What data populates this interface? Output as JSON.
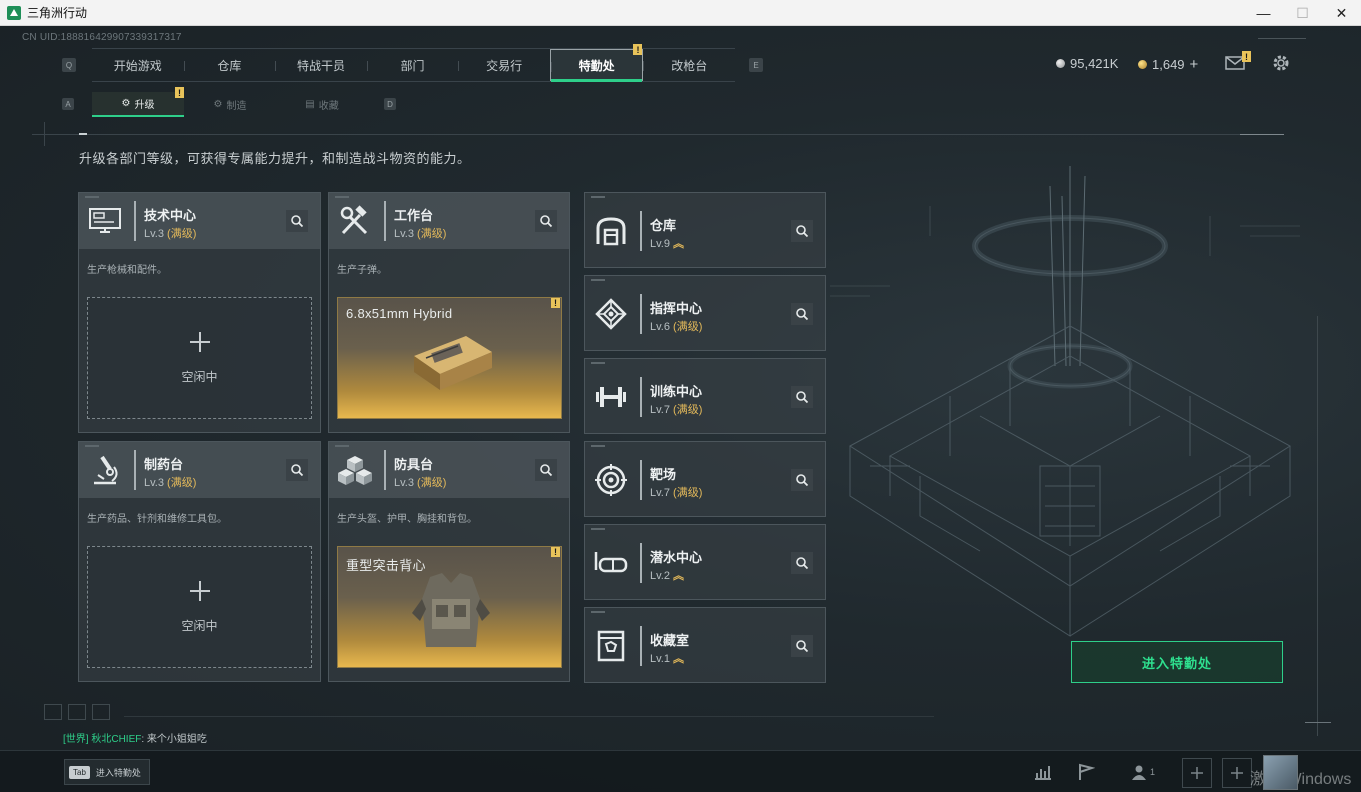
{
  "window": {
    "title": "三角洲行动",
    "minimize": "—",
    "restore": "☐",
    "close": "✕"
  },
  "uid": "CN UID:188816429907339317317",
  "topnav": {
    "left_key": "Q",
    "right_key": "E",
    "tabs": [
      {
        "label": "开始游戏",
        "active": false
      },
      {
        "label": "仓库",
        "active": false
      },
      {
        "label": "特战干员",
        "active": false
      },
      {
        "label": "部门",
        "active": false
      },
      {
        "label": "交易行",
        "active": false
      },
      {
        "label": "特勤处",
        "active": true,
        "badge": "!"
      },
      {
        "label": "改枪台",
        "active": false
      }
    ]
  },
  "currency": {
    "silver": "95,421K",
    "gold": "1,649",
    "gold_add": "+"
  },
  "mail_badge": "!",
  "subnav": {
    "left_key": "A",
    "right_key": "D",
    "tabs": [
      {
        "label": "升级",
        "active": true,
        "badge": "!"
      },
      {
        "label": "制造",
        "active": false
      },
      {
        "label": "收藏",
        "active": false
      }
    ]
  },
  "description": "升级各部门等级，可获得专属能力提升，和制造战斗物资的能力。",
  "stations": [
    {
      "name": "技术中心",
      "level_prefix": "Lv.3",
      "level_tag": "(满级)",
      "desc": "生产枪械和配件。",
      "slot": {
        "type": "idle",
        "label": "空闲中"
      }
    },
    {
      "name": "工作台",
      "level_prefix": "Lv.3",
      "level_tag": "(满级)",
      "desc": "生产子弹。",
      "slot": {
        "type": "product",
        "label": "6.8x51mm Hybrid",
        "badge": "!"
      }
    },
    {
      "name": "制药台",
      "level_prefix": "Lv.3",
      "level_tag": "(满级)",
      "desc": "生产药品、针剂和维修工具包。",
      "slot": {
        "type": "idle",
        "label": "空闲中"
      }
    },
    {
      "name": "防具台",
      "level_prefix": "Lv.3",
      "level_tag": "(满级)",
      "desc": "生产头盔、护甲、胸挂和背包。",
      "slot": {
        "type": "product",
        "label": "重型突击背心",
        "badge": "!"
      }
    }
  ],
  "facilities": [
    {
      "name": "仓库",
      "level_prefix": "Lv.9",
      "level_tag": "",
      "upgrade": "︽",
      "icon": "warehouse-icon"
    },
    {
      "name": "指挥中心",
      "level_prefix": "Lv.6",
      "level_tag": "(满级)",
      "upgrade": "",
      "icon": "command-center-icon"
    },
    {
      "name": "训练中心",
      "level_prefix": "Lv.7",
      "level_tag": "(满级)",
      "upgrade": "",
      "icon": "dumbbell-icon"
    },
    {
      "name": "靶场",
      "level_prefix": "Lv.7",
      "level_tag": "(满级)",
      "upgrade": "",
      "icon": "target-icon"
    },
    {
      "name": "潜水中心",
      "level_prefix": "Lv.2",
      "level_tag": "",
      "upgrade": "︽",
      "icon": "diving-mask-icon"
    },
    {
      "name": "收藏室",
      "level_prefix": "Lv.1",
      "level_tag": "",
      "upgrade": "︽",
      "icon": "collection-icon"
    }
  ],
  "enter_button": "进入特勤处",
  "chat": {
    "channel": "[世界]",
    "user": "秋北CHIEF",
    "separator": ":",
    "message": "来个小姐姐吃"
  },
  "bottom": {
    "tab_key": "Tab",
    "tab_label": "进入特勤处",
    "friends_count": "1",
    "watermark": "激活 Windows"
  }
}
